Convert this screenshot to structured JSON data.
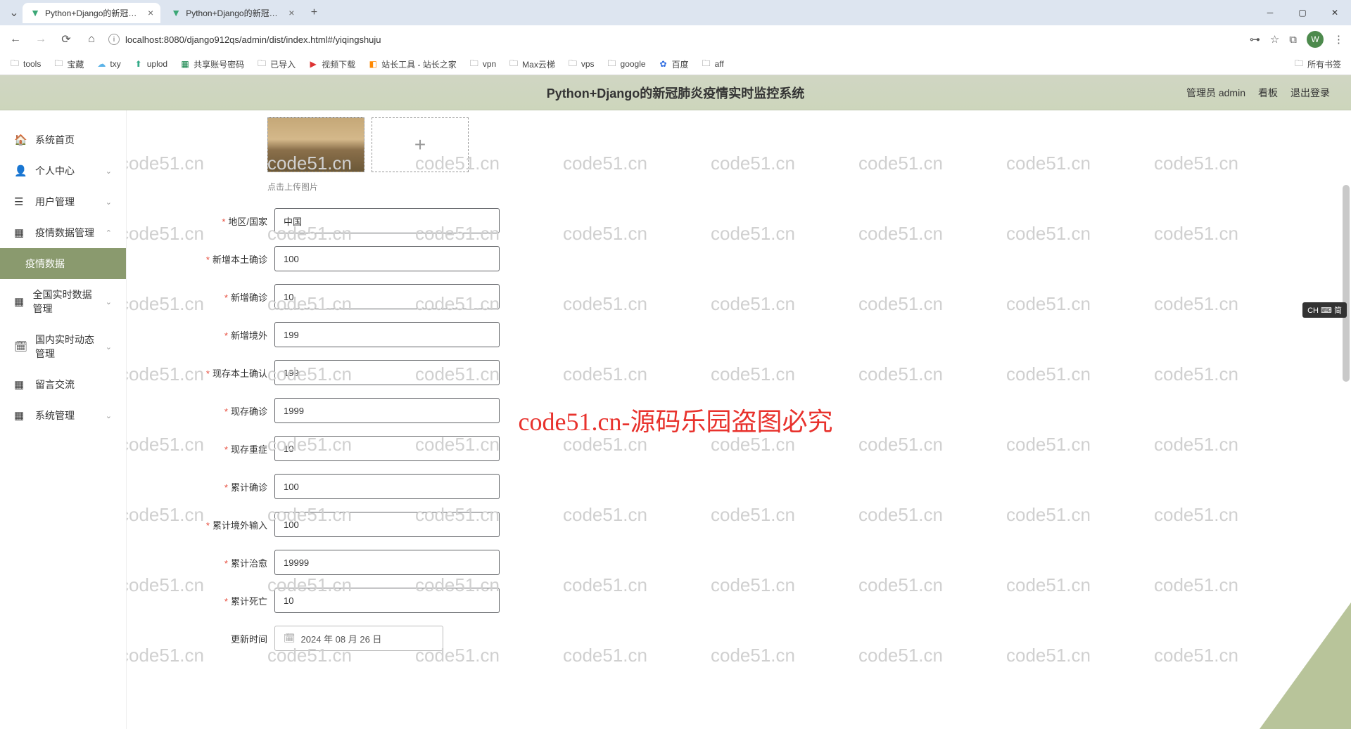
{
  "browser": {
    "tabs": [
      {
        "title": "Python+Django的新冠肺炎疫"
      },
      {
        "title": "Python+Django的新冠肺炎疫"
      }
    ],
    "url": "localhost:8080/django912qs/admin/dist/index.html#/yiqingshuju",
    "bookmarks": [
      "tools",
      "宝藏",
      "txy",
      "uplod",
      "共享账号密码",
      "已导入",
      "视频下载",
      "站长工具 - 站长之家",
      "vpn",
      "Max云梯",
      "vps",
      "google",
      "百度",
      "aff"
    ],
    "all_bookmarks": "所有书签",
    "profile_letter": "W"
  },
  "header": {
    "title": "Python+Django的新冠肺炎疫情实时监控系统",
    "admin": "管理员 admin",
    "dashboard": "看板",
    "logout": "退出登录"
  },
  "sidebar": {
    "items": [
      {
        "icon": "home",
        "label": "系统首页",
        "chev": false
      },
      {
        "icon": "user",
        "label": "个人中心",
        "chev": true
      },
      {
        "icon": "list",
        "label": "用户管理",
        "chev": true
      },
      {
        "icon": "grid",
        "label": "疫情数据管理",
        "chev": true,
        "expanded": true
      },
      {
        "icon": "",
        "label": "疫情数据",
        "active": true
      },
      {
        "icon": "grid",
        "label": "全国实时数据管理",
        "chev": true
      },
      {
        "icon": "cal",
        "label": "国内实时动态管理",
        "chev": true
      },
      {
        "icon": "grid2",
        "label": "留言交流",
        "chev": false
      },
      {
        "icon": "grid3",
        "label": "系统管理",
        "chev": true
      }
    ]
  },
  "form": {
    "upload_hint": "点击上传图片",
    "fields": [
      {
        "label": "地区/国家",
        "value": "中国",
        "required": true
      },
      {
        "label": "新增本土确诊",
        "value": "100",
        "required": true
      },
      {
        "label": "新增确诊",
        "value": "10",
        "required": true
      },
      {
        "label": "新增境外",
        "value": "199",
        "required": true
      },
      {
        "label": "现存本土确认",
        "value": "199",
        "required": true
      },
      {
        "label": "现存确诊",
        "value": "1999",
        "required": true
      },
      {
        "label": "现存重症",
        "value": "10",
        "required": true
      },
      {
        "label": "累计确诊",
        "value": "100",
        "required": true
      },
      {
        "label": "累计境外输入",
        "value": "100",
        "required": true
      },
      {
        "label": "累计治愈",
        "value": "19999",
        "required": true
      },
      {
        "label": "累计死亡",
        "value": "10",
        "required": true
      }
    ],
    "date_label": "更新时间",
    "date_value": "2024 年 08 月 26 日"
  },
  "watermark": {
    "text": "code51.cn",
    "red": "code51.cn-源码乐园盗图必究"
  },
  "ime": "CH ⌨ 简"
}
